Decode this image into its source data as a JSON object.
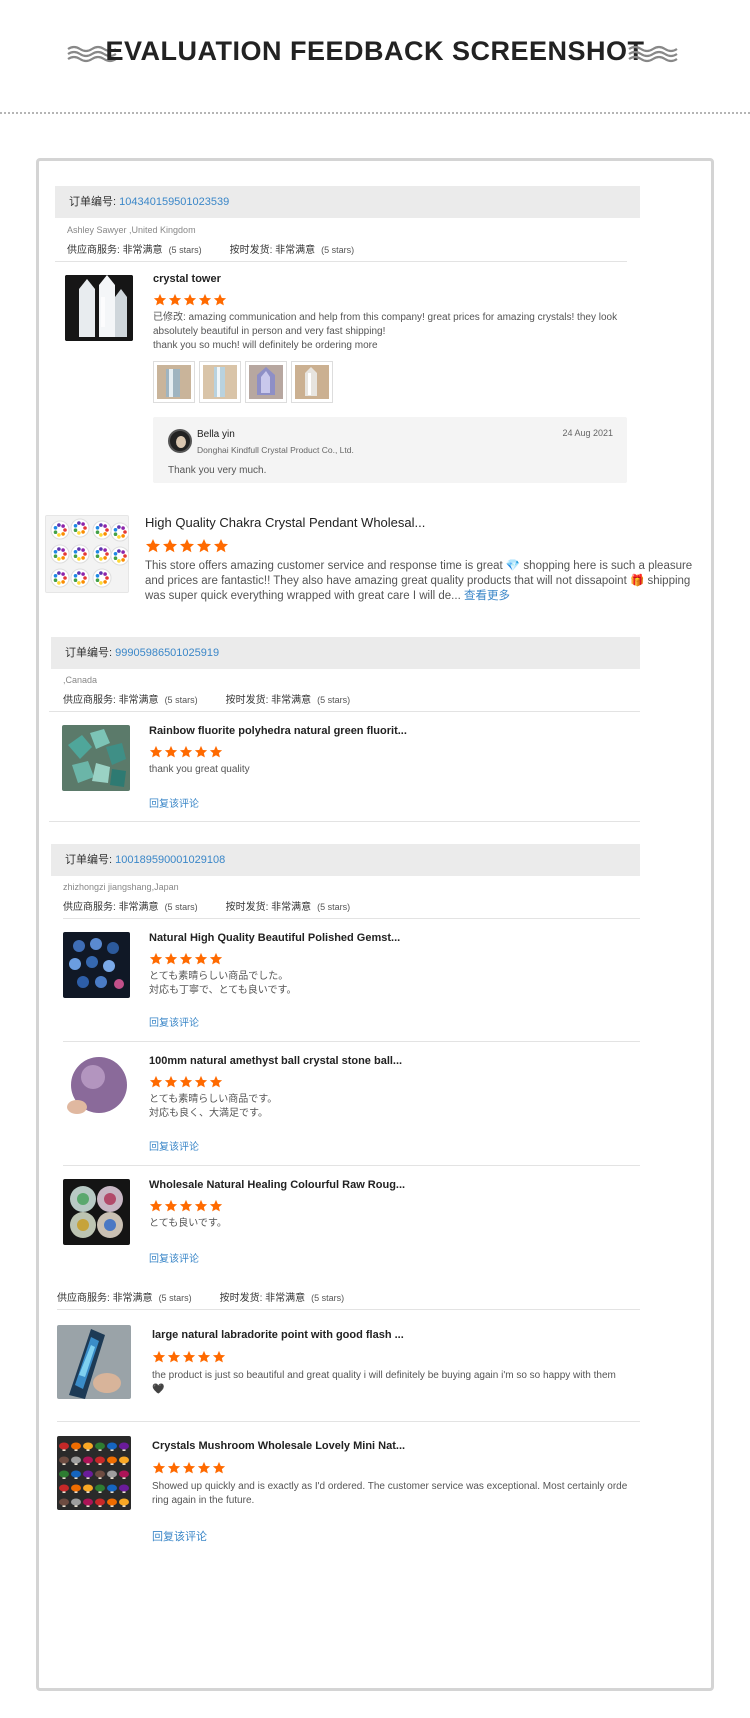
{
  "header": {
    "title": "EVALUATION FEEDBACK SCREENSHOT"
  },
  "colors": {
    "star": "#ff6a00",
    "link": "#3b87c8",
    "bar": "#ebebeb"
  },
  "icons": [
    "wave-decoration-icon",
    "star-icon",
    "avatar-icon"
  ],
  "block1": {
    "order_label": "订单编号:",
    "order_number": "104340159501023539",
    "buyer": "Ashley Sawyer ,United Kingdom",
    "service_label": "供应商服务:",
    "service_value": "非常满意",
    "service_stars": "(5 stars)",
    "shipping_label": "按时发货:",
    "shipping_value": "非常满意",
    "shipping_stars": "(5 stars)",
    "product": "crystal tower",
    "rating": 5,
    "review_line1": "已修改: amazing communication and help from this company! great prices for amazing crystals! they look",
    "review_line2": "absolutely beautiful in person and very fast shipping!",
    "review_line3": "thank you so much! will definitely be ordering more",
    "reply": {
      "name": "Bella yin",
      "company": "Donghai Kindfull Crystal Product Co., Ltd.",
      "date": "24 Aug 2021",
      "text": "Thank you very much."
    }
  },
  "block2": {
    "product": "High Quality Chakra Crystal Pendant Wholesal...",
    "rating": 5,
    "review_line1": "This store offers amazing customer service and response time is great 💎 shopping here is such a pleasure",
    "review_line2": "and prices are fantastic!! They also have amazing great quality products that will not dissapoint 🎁 shipping",
    "review_line3": "was super quick everything wrapped with great care I will de...",
    "more": "查看更多"
  },
  "block3": {
    "order_label": "订单编号:",
    "order_number": "99905986501025919",
    "buyer": ",Canada",
    "service_label": "供应商服务:",
    "service_value": "非常满意",
    "service_stars": "(5 stars)",
    "shipping_label": "按时发货:",
    "shipping_value": "非常满意",
    "shipping_stars": "(5 stars)",
    "product": "Rainbow fluorite polyhedra natural green fluorit...",
    "rating": 5,
    "review": "thank you great quality",
    "reply_link": "回复该评论"
  },
  "block4": {
    "order_label": "订单编号:",
    "order_number": "100189590001029108",
    "buyer": "zhizhongzi jiangshang,Japan",
    "service_label": "供应商服务:",
    "service_value": "非常满意",
    "service_stars": "(5 stars)",
    "shipping_label": "按时发货:",
    "shipping_value": "非常满意",
    "shipping_stars": "(5 stars)",
    "items": [
      {
        "product": "Natural High Quality Beautiful Polished Gemst...",
        "rating": 5,
        "review_line1": "とても素晴らしい商品でした。",
        "review_line2": "対応も丁寧で、とても良いです。",
        "reply_link": "回复该评论"
      },
      {
        "product": "100mm natural amethyst ball crystal stone ball...",
        "rating": 5,
        "review_line1": "とても素晴らしい商品です。",
        "review_line2": "対応も良く、大満足です。",
        "reply_link": "回复该评论"
      },
      {
        "product": "Wholesale Natural Healing Colourful Raw Roug...",
        "rating": 5,
        "review_line1": "とても良いです。",
        "review_line2": "",
        "reply_link": "回复该评论"
      }
    ]
  },
  "block5": {
    "service_label": "供应商服务:",
    "service_value": "非常满意",
    "service_stars": "(5 stars)",
    "shipping_label": "按时发货:",
    "shipping_value": "非常满意",
    "shipping_stars": "(5 stars)",
    "items": [
      {
        "product": "large natural labradorite point with good flash ...",
        "rating": 5,
        "review_line1": "the product is just so beautiful and great quality i will definitely be buying again i'm so so happy with them",
        "review_line2": "🖤"
      },
      {
        "product": "Crystals Mushroom Wholesale Lovely Mini Nat...",
        "rating": 5,
        "review_line1": "Showed up quickly and is exactly as I'd ordered. The customer service was exceptional. Most certainly orde",
        "review_line2": "ring again in the future.",
        "reply_link": "回复该评论"
      }
    ]
  }
}
